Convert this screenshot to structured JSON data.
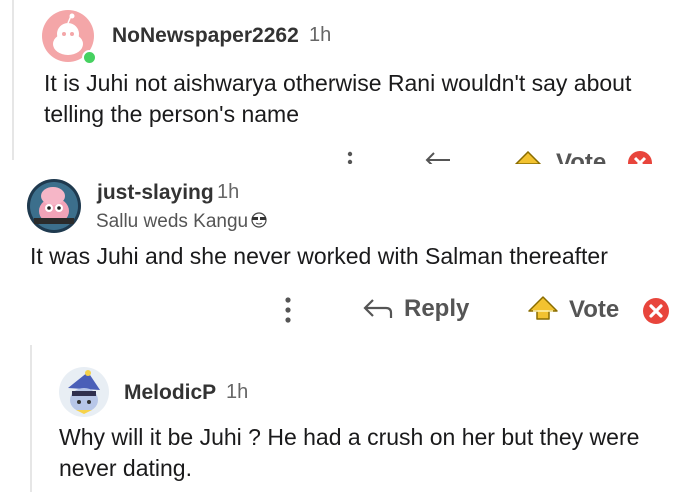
{
  "comments": [
    {
      "username": "NoNewspaper2262",
      "time": "1h",
      "body": "It is Juhi  not aishwarya otherwise Rani wouldn't say about telling  the person's name",
      "avatar_icon": "snoo-avatar-icon",
      "avatar_color": "#f4a6a8"
    },
    {
      "username": "just-slaying",
      "time": "1h",
      "flair": "Sallu weds Kangu",
      "flair_icon": "sunglasses-emoji-icon",
      "body": "It was Juhi and she never worked with Salman thereafter",
      "avatar_icon": "pink-character-avatar-icon"
    },
    {
      "username": "MelodicP",
      "time": "1h",
      "body": "Why will it be Juhi ? He had a crush on her but they were never dating.",
      "avatar_icon": "wizard-character-avatar-icon"
    }
  ],
  "actions": {
    "reply_label": "Reply",
    "vote_label": "Vote",
    "cut_vote_label": "Vote"
  },
  "colors": {
    "upvote_gold": "#f2c230",
    "downvote_red": "#e8453c",
    "online_green": "#46d160",
    "thread_line": "#e6e6e6"
  }
}
